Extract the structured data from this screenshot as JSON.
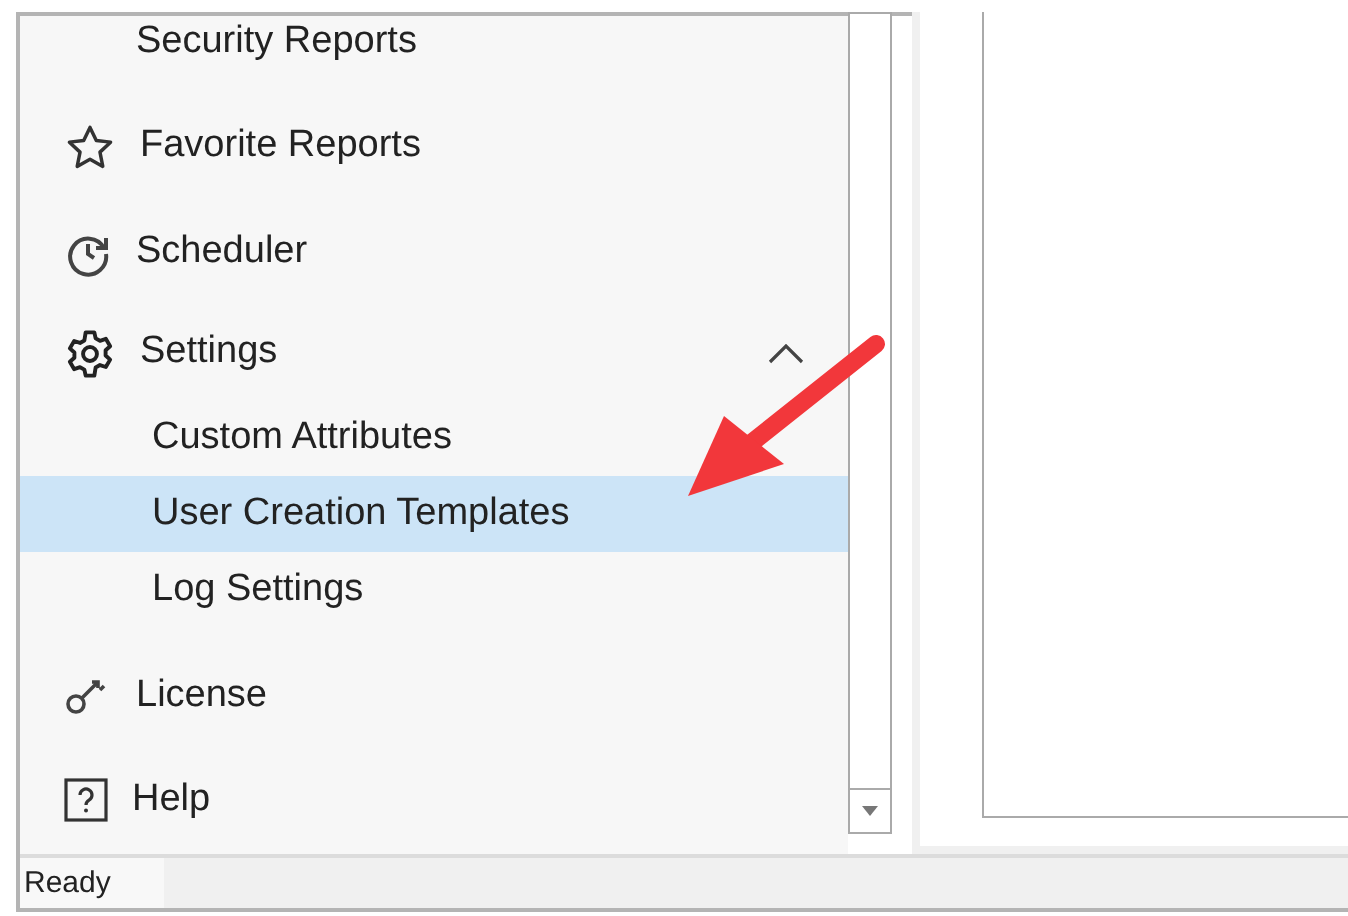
{
  "sidebar": {
    "items": [
      {
        "label": "Security Reports",
        "kind": "child",
        "selected": false
      },
      {
        "label": "Favorite Reports",
        "kind": "item",
        "selected": false
      },
      {
        "label": "Scheduler",
        "kind": "item",
        "selected": false
      },
      {
        "label": "Settings",
        "kind": "item",
        "selected": false,
        "expanded": true,
        "children": [
          {
            "label": "Custom Attributes",
            "selected": false
          },
          {
            "label": "User Creation Templates",
            "selected": true
          },
          {
            "label": "Log Settings",
            "selected": false
          }
        ]
      },
      {
        "label": "License",
        "kind": "item",
        "selected": false
      },
      {
        "label": "Help",
        "kind": "item",
        "selected": false
      }
    ]
  },
  "status_bar": {
    "text": "Ready"
  }
}
